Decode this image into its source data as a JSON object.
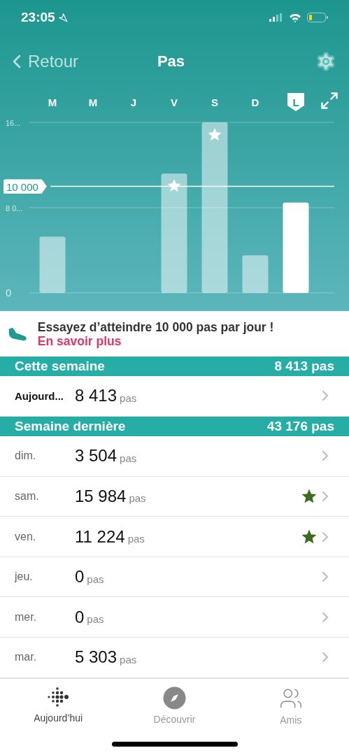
{
  "status_bar": {
    "time": "23:05"
  },
  "nav": {
    "back": "Retour",
    "title": "Pas"
  },
  "chart": {
    "y_labels": [
      "16...",
      "8 0...",
      "0"
    ],
    "goal": {
      "label": "10 000"
    },
    "bars": [
      {
        "label": "M",
        "selected": false,
        "starred": false
      },
      {
        "label": "M",
        "selected": false
      },
      {
        "label": "J",
        "selected": false
      },
      {
        "label": "V",
        "selected": false,
        "starred": true
      },
      {
        "label": "S",
        "selected": false,
        "starred": true
      },
      {
        "label": "D",
        "selected": false,
        "starred": false
      },
      {
        "label": "L",
        "selected": true,
        "starred": false
      }
    ]
  },
  "tip": {
    "text": "Essayez d’atteindre 10 000 pas par jour !",
    "link": "En savoir plus"
  },
  "sections": [
    {
      "title": "Cette semaine",
      "total": "8 413 pas",
      "rows": [
        {
          "kind": "today",
          "day": "Aujourd...",
          "steps": "8 413",
          "unit": "pas",
          "star": false
        }
      ]
    },
    {
      "title": "Semaine dernière",
      "total": "43 176 pas",
      "rows": [
        {
          "kind": "day",
          "day": "dim.",
          "steps": "3 504",
          "unit": "pas",
          "star": false
        },
        {
          "kind": "day",
          "day": "sam.",
          "steps": "15 984",
          "unit": "pas",
          "star": true
        },
        {
          "kind": "day",
          "day": "ven.",
          "steps": "11 224",
          "unit": "pas",
          "star": true
        },
        {
          "kind": "day",
          "day": "jeu.",
          "steps": "0",
          "unit": "pas",
          "star": false
        },
        {
          "kind": "day",
          "day": "mer.",
          "steps": "0",
          "unit": "pas",
          "star": false
        },
        {
          "kind": "day",
          "day": "mar.",
          "steps": "5 303",
          "unit": "pas",
          "star": false
        }
      ]
    }
  ],
  "tab_bar": [
    {
      "label": "Aujourd’hui",
      "kind": "today",
      "selected": true
    },
    {
      "label": "Découvrir",
      "kind": "discover",
      "selected": false
    },
    {
      "label": "Amis",
      "kind": "friends",
      "selected": false
    }
  ]
}
